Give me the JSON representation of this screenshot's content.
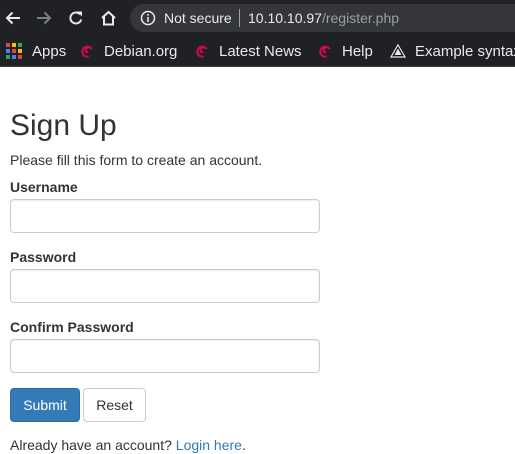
{
  "browser": {
    "security_label": "Not secure",
    "url_host": "10.10.10.97",
    "url_path": "/register.php",
    "icons": {
      "back": "arrow-left-icon",
      "forward": "arrow-right-icon",
      "reload": "reload-icon",
      "home": "home-icon",
      "info": "info-icon"
    },
    "bookmarks": [
      {
        "label": "Apps",
        "icon": "apps-grid-icon"
      },
      {
        "label": "Debian.org",
        "icon": "debian-swirl-icon"
      },
      {
        "label": "Latest News",
        "icon": "debian-swirl-icon"
      },
      {
        "label": "Help",
        "icon": "debian-swirl-icon"
      },
      {
        "label": "Example syntax",
        "icon": "triangle-logo-icon"
      }
    ]
  },
  "form": {
    "title": "Sign Up",
    "subtitle": "Please fill this form to create an account.",
    "username_label": "Username",
    "username_value": "",
    "password_label": "Password",
    "password_value": "",
    "confirm_label": "Confirm Password",
    "confirm_value": "",
    "submit_label": "Submit",
    "reset_label": "Reset",
    "login_prompt": "Already have an account?",
    "login_link": "Login here",
    "login_suffix": "."
  },
  "colors": {
    "primary": "#337ab7",
    "chrome_bg": "#202124",
    "debian_red": "#d70751"
  }
}
